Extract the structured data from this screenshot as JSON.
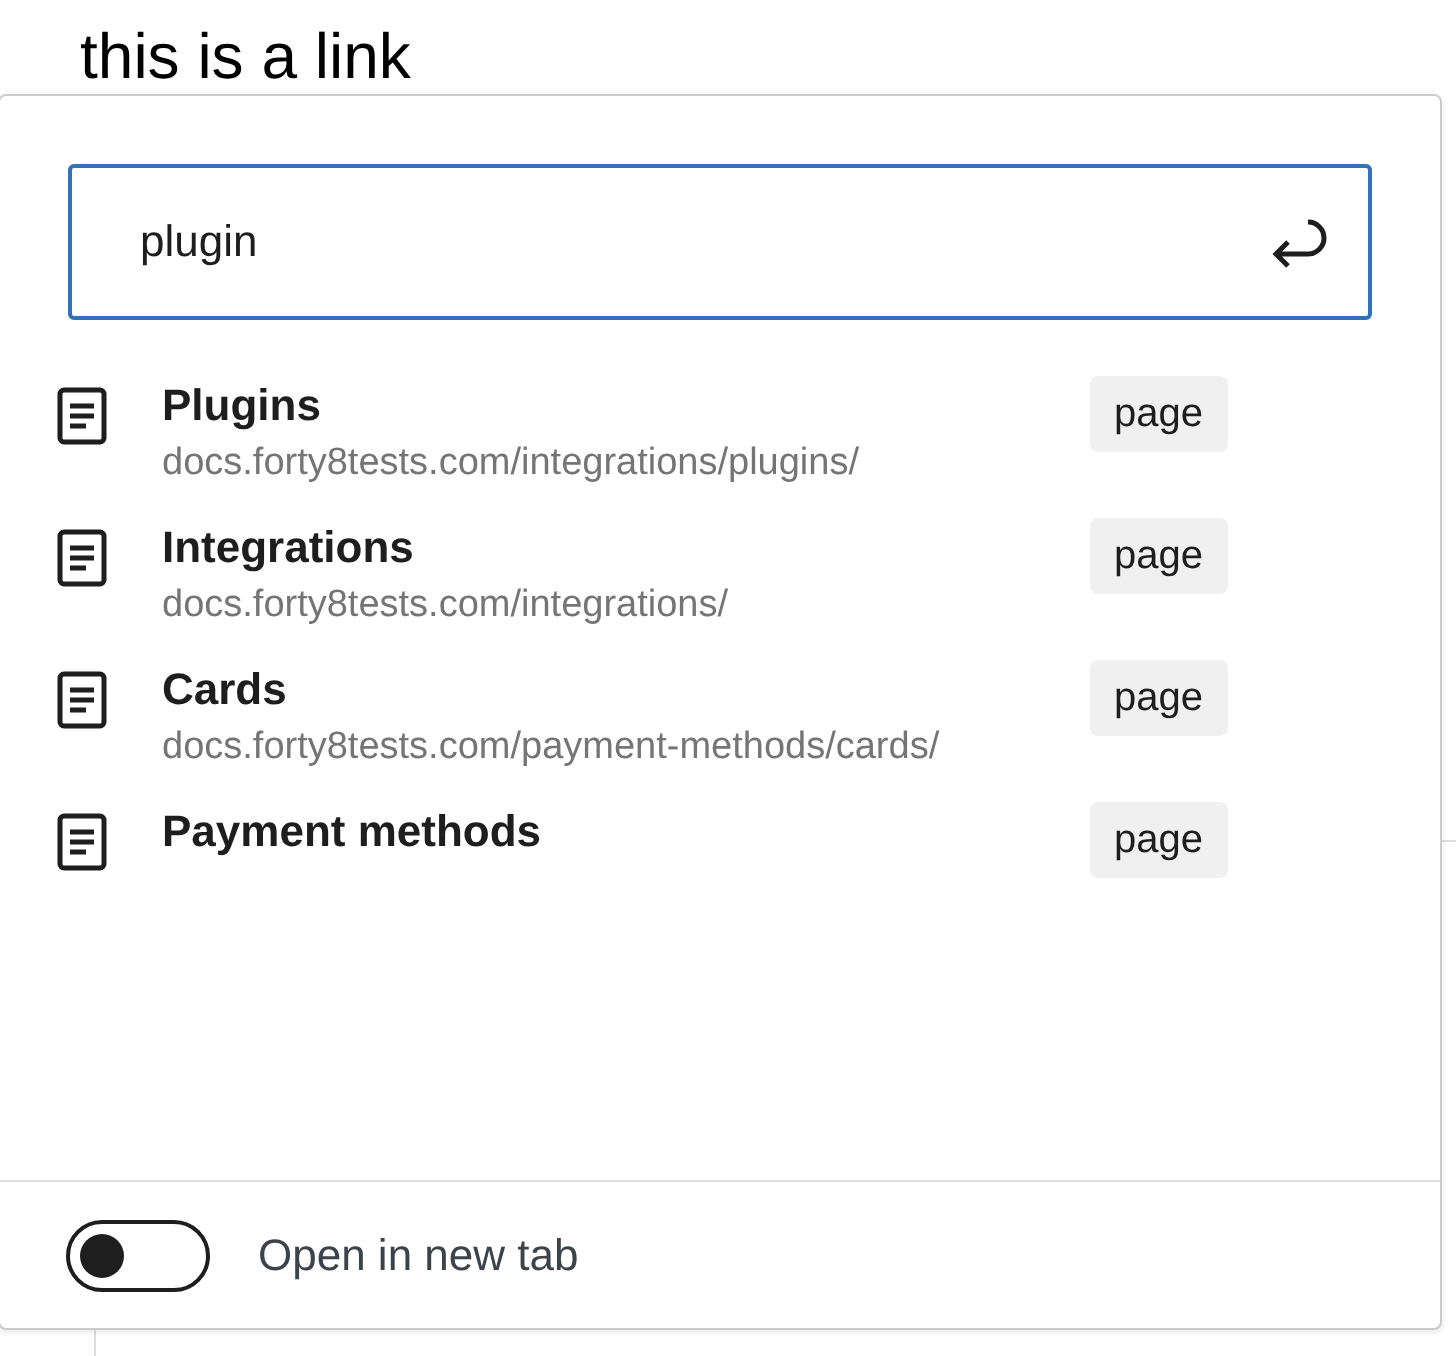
{
  "heading": "this is a link",
  "search": {
    "value": "plugin"
  },
  "results": [
    {
      "title": "Plugins",
      "url": "docs.forty8tests.com/integrations/plugins/",
      "badge": "page"
    },
    {
      "title": "Integrations",
      "url": "docs.forty8tests.com/integrations/",
      "badge": "page"
    },
    {
      "title": "Cards",
      "url": "docs.forty8tests.com/payment-methods/cards/",
      "badge": "page"
    },
    {
      "title": "Payment methods",
      "badge": "page"
    }
  ],
  "new_tab": {
    "label": "Open in new tab",
    "on": false
  }
}
